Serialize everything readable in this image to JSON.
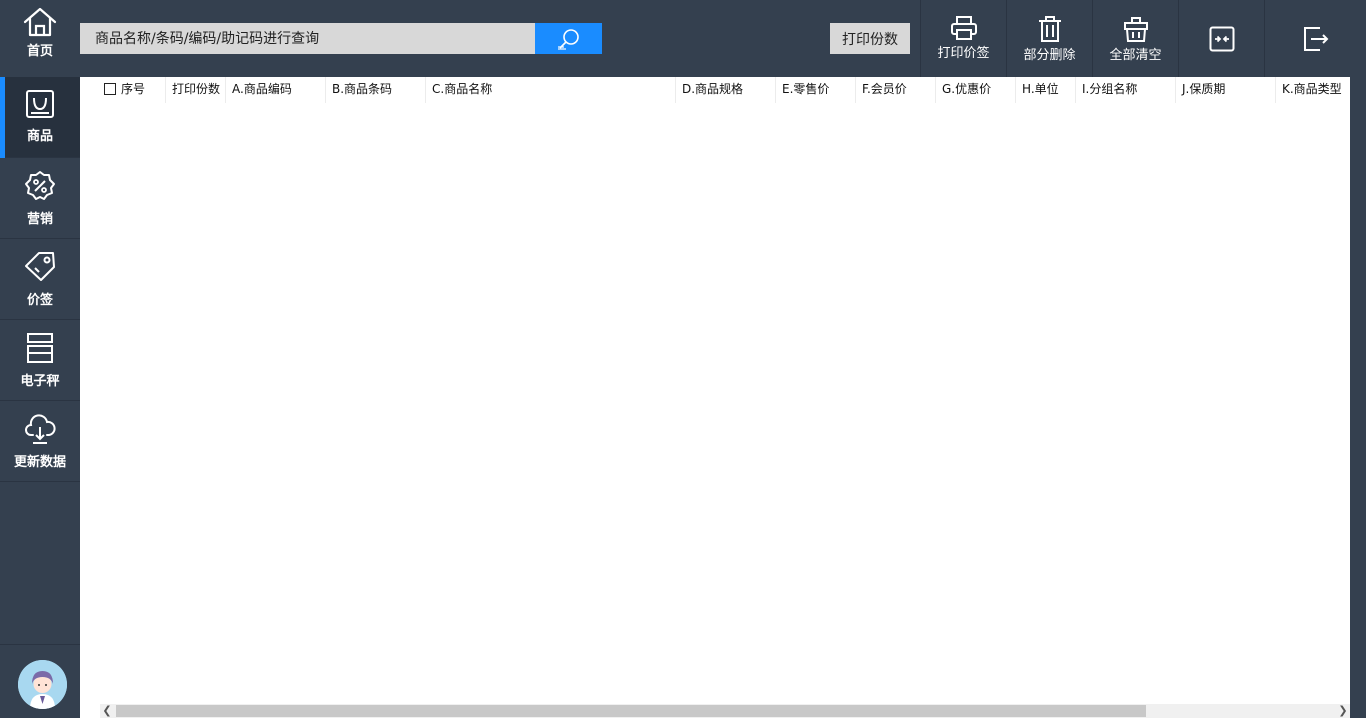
{
  "sidebar": {
    "home": {
      "label": "首页",
      "icon": "home-icon"
    },
    "items": [
      {
        "label": "商品",
        "icon": "shopping-bag-icon",
        "active": true
      },
      {
        "label": "营销",
        "icon": "discount-badge-icon",
        "active": false
      },
      {
        "label": "价签",
        "icon": "price-tag-icon",
        "active": false
      },
      {
        "label": "电子秤",
        "icon": "scale-icon",
        "active": false
      },
      {
        "label": "更新数据",
        "icon": "cloud-download-icon",
        "active": false
      }
    ]
  },
  "toolbar": {
    "search_placeholder": "商品名称/条码/编码/助记码进行查询",
    "search_icon": "search-icon",
    "copies_label": "打印份数",
    "print_label": "打印价签",
    "partial_delete_label": "部分删除",
    "clear_all_label": "全部清空",
    "collapse_icon": "collapse-icon",
    "exit_icon": "exit-icon"
  },
  "table": {
    "columns": [
      "序号",
      "打印份数",
      "A.商品编码",
      "B.商品条码",
      "C.商品名称",
      "D.商品规格",
      "E.零售价",
      "F.会员价",
      "G.优惠价",
      "H.单位",
      "I.分组名称",
      "J.保质期",
      "K.商品类型"
    ],
    "rows": []
  },
  "colors": {
    "sidebar_bg": "#34404f",
    "accent": "#1a8cff",
    "content_bg": "#ffffff"
  }
}
